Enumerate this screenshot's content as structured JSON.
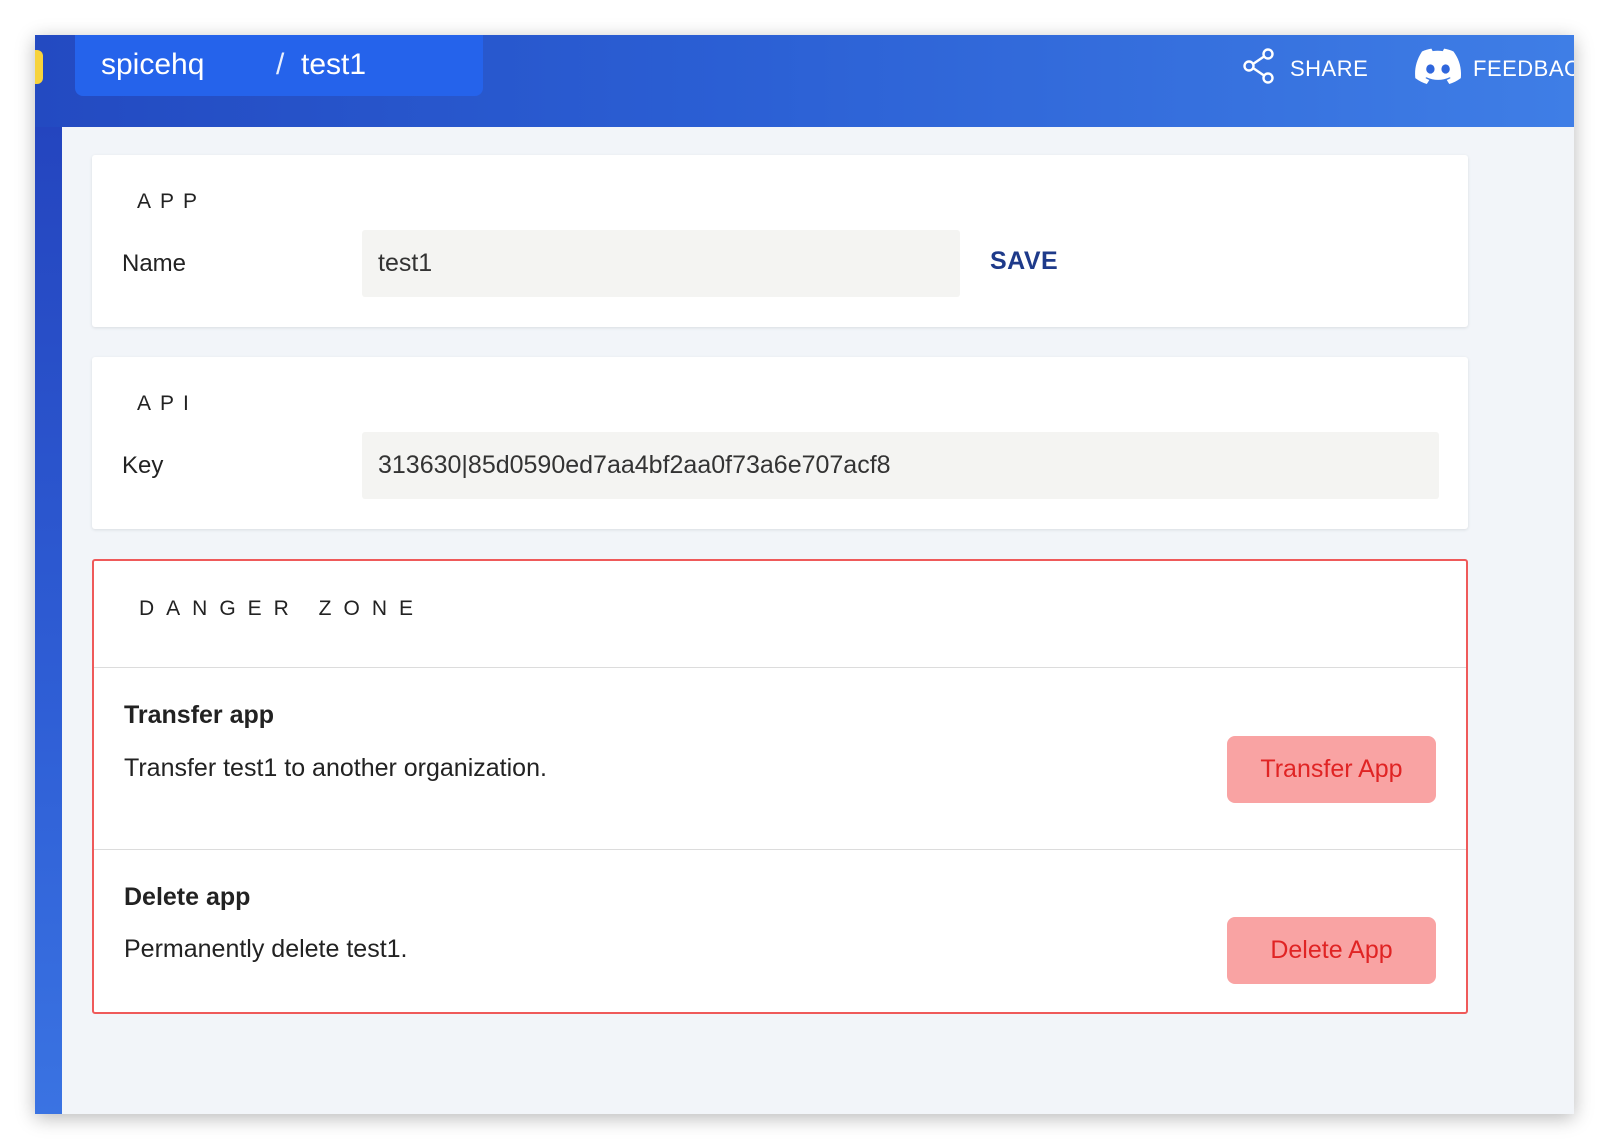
{
  "header": {
    "org": "spicehq",
    "separator": "/",
    "app": "test1",
    "share_label": "SHARE",
    "share_icon": "share-icon",
    "feedback_label": "FEEDBACK",
    "feedback_icon": "discord-icon",
    "colors": {
      "bar_start": "#234ac1",
      "bar_end": "#3f7ee6",
      "breadcrumb_bg": "#2563eb"
    }
  },
  "app_section": {
    "title": "APP",
    "name_label": "Name",
    "name_value": "test1",
    "save_label": "SAVE"
  },
  "api_section": {
    "title": "API",
    "key_label": "Key",
    "key_value": "313630|85d0590ed7aa4bf2aa0f73a6e707acf8"
  },
  "danger_zone": {
    "title": "DANGER ZONE",
    "border_color": "#ef5a5a",
    "transfer": {
      "title": "Transfer app",
      "description": "Transfer test1 to another organization.",
      "button_label": "Transfer App"
    },
    "delete": {
      "title": "Delete app",
      "description": "Permanently delete test1.",
      "button_label": "Delete App"
    },
    "button_bg": "#f9a3a3",
    "button_text_color": "#e02424"
  }
}
